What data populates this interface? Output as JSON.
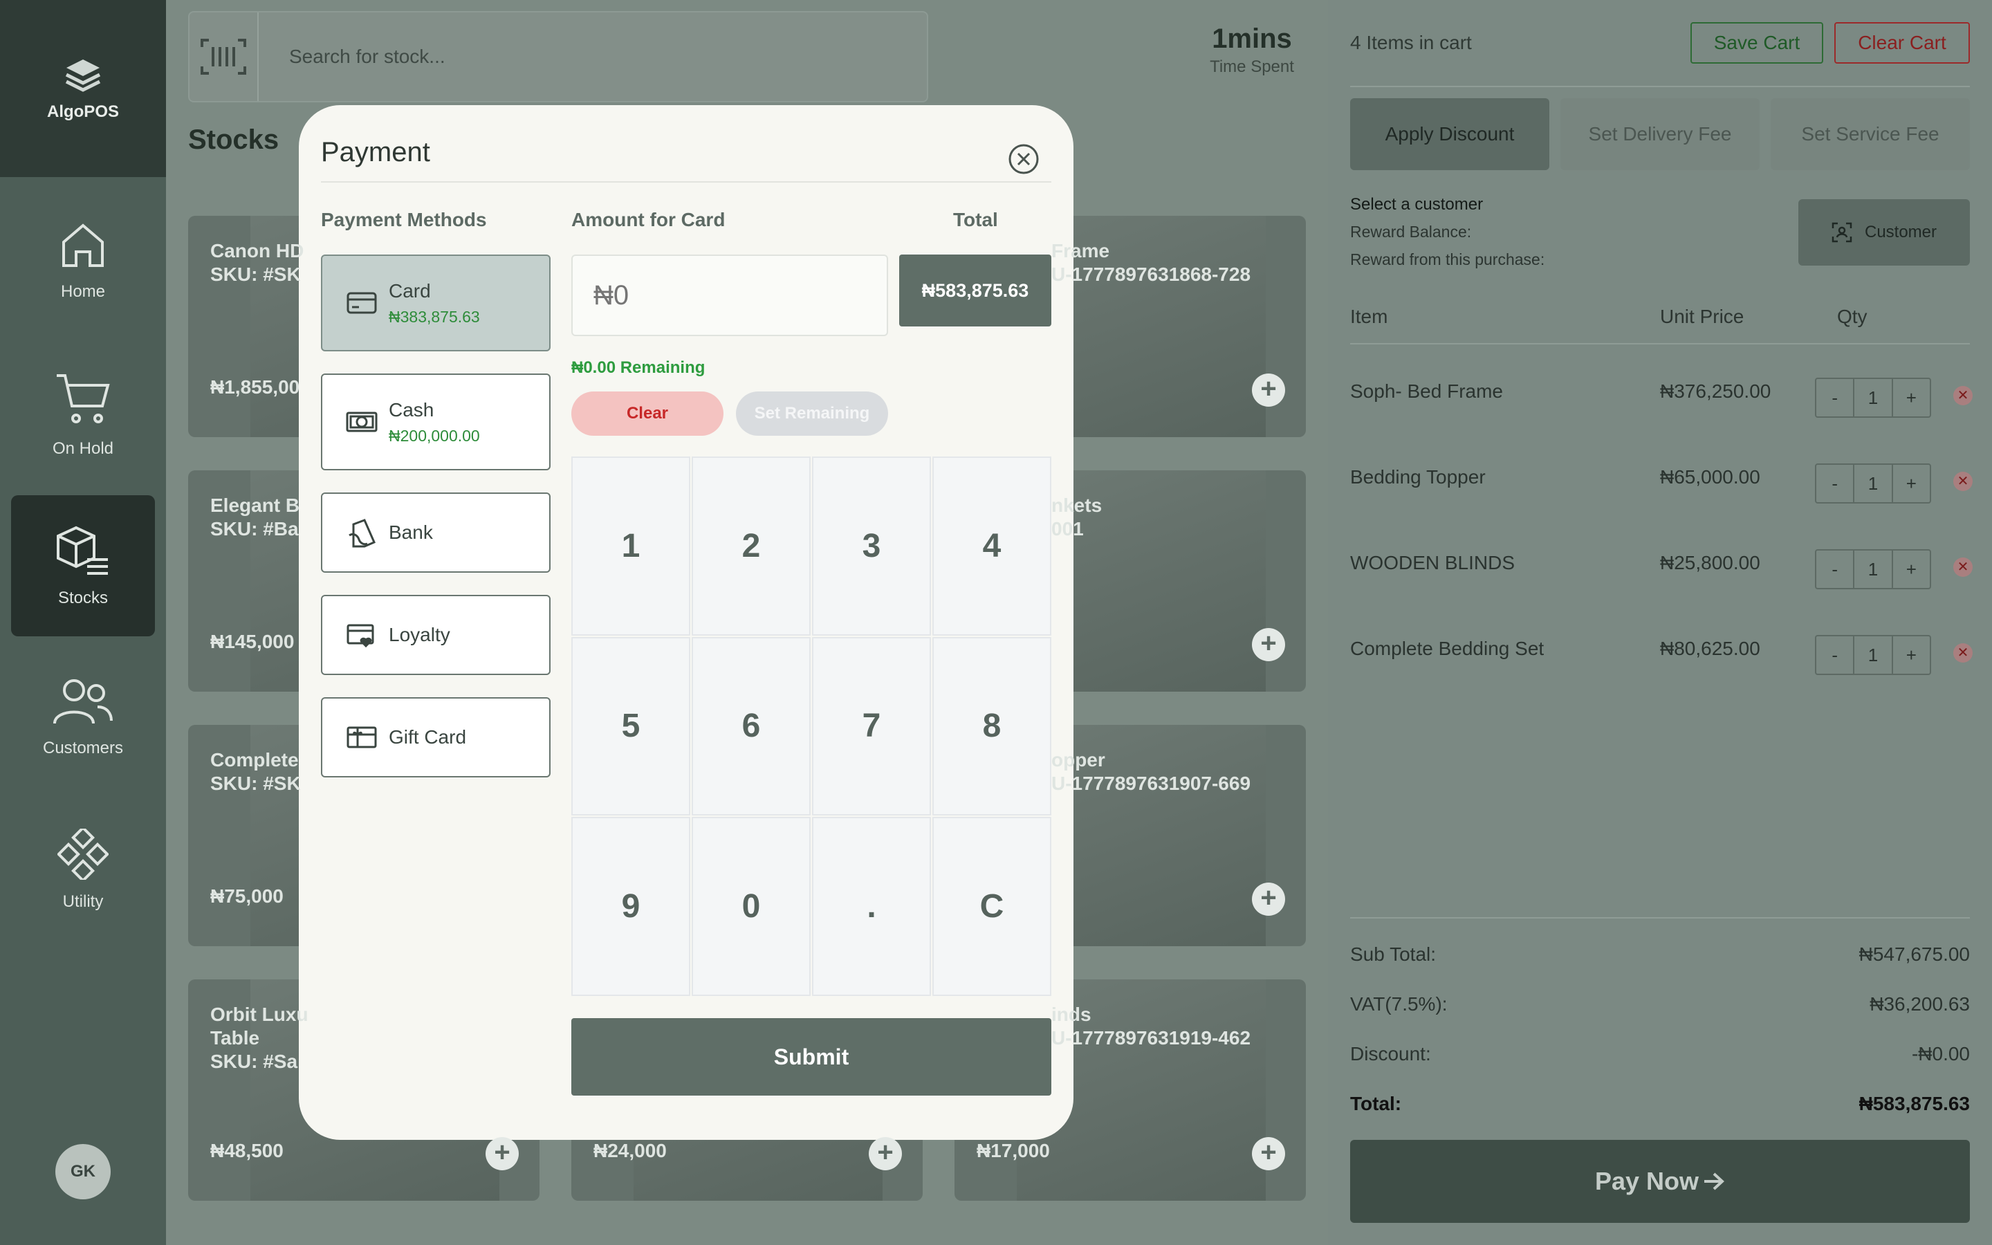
{
  "sidebar": {
    "brand": "AlgoPOS",
    "items": [
      {
        "label": "Home",
        "icon": "home-icon"
      },
      {
        "label": "On Hold",
        "icon": "cart-icon"
      },
      {
        "label": "Stocks",
        "icon": "box-list-icon",
        "active": true
      },
      {
        "label": "Customers",
        "icon": "users-icon"
      },
      {
        "label": "Utility",
        "icon": "diamonds-icon"
      }
    ],
    "avatar_initials": "GK"
  },
  "header": {
    "search_placeholder": "Search for stock...",
    "timer_value": "1mins",
    "timer_label": "Time Spent"
  },
  "stocks": {
    "title": "Stocks",
    "cards": [
      {
        "name": "Canon HD\nSKU: #SK",
        "price": "₦1,855,00"
      },
      {
        "name": "Frame\nU-1777897631868-728",
        "price": ""
      },
      {
        "name": "Elegant B\nSKU: #Ba",
        "price": "₦145,000"
      },
      {
        "name": "nkets\n001",
        "price": ""
      },
      {
        "name": "Complete\nSKU: #SK",
        "price": "₦75,000"
      },
      {
        "name": "opper\nU-1777897631907-669",
        "price": ""
      },
      {
        "name": "Orbit Luxu\nTable\nSKU: #Sa",
        "price": "₦48,500"
      },
      {
        "name": "",
        "price": "₦24,000"
      },
      {
        "name": "inds\nU-1777897631919-462",
        "price": "₦17,000"
      }
    ]
  },
  "cart": {
    "count_text": "4 Items in cart",
    "save_label": "Save Cart",
    "clear_label": "Clear Cart",
    "apply_discount": "Apply Discount",
    "set_delivery": "Set Delivery Fee",
    "set_service": "Set Service Fee",
    "select_customer": "Select a customer",
    "reward_balance": "Reward Balance:",
    "reward_purchase": "Reward from this purchase:",
    "customer_button": "Customer",
    "headers": {
      "item": "Item",
      "unit_price": "Unit Price",
      "qty": "Qty"
    },
    "items": [
      {
        "name": "Soph- Bed Frame",
        "price": "₦376,250.00",
        "qty": "1"
      },
      {
        "name": "Bedding Topper",
        "price": "₦65,000.00",
        "qty": "1"
      },
      {
        "name": "WOODEN BLINDS",
        "price": "₦25,800.00",
        "qty": "1"
      },
      {
        "name": "Complete Bedding Set",
        "price": "₦80,625.00",
        "qty": "1"
      }
    ],
    "subtotal_label": "Sub Total:",
    "subtotal": "₦547,675.00",
    "vat_label": "VAT(7.5%):",
    "vat": "₦36,200.63",
    "discount_label": "Discount:",
    "discount": "-₦0.00",
    "total_label": "Total:",
    "total": "₦583,875.63",
    "pay_now": "Pay Now"
  },
  "payment": {
    "title": "Payment",
    "methods_heading": "Payment Methods",
    "amount_heading": "Amount for Card",
    "total_heading": "Total",
    "methods": [
      {
        "label": "Card",
        "amount": "₦383,875.63",
        "icon": "card-icon",
        "selected": true
      },
      {
        "label": "Cash",
        "amount": "₦200,000.00",
        "icon": "cash-icon"
      },
      {
        "label": "Bank",
        "amount": "",
        "icon": "bank-icon"
      },
      {
        "label": "Loyalty",
        "amount": "",
        "icon": "loyalty-icon"
      },
      {
        "label": "Gift Card",
        "amount": "",
        "icon": "gift-card-icon"
      }
    ],
    "amount_placeholder": "₦0",
    "total": "₦583,875.63",
    "remaining": "₦0.00 Remaining",
    "clear_label": "Clear",
    "set_remaining_label": "Set Remaining",
    "keys": [
      "1",
      "2",
      "3",
      "4",
      "5",
      "6",
      "7",
      "8",
      "9",
      "0",
      ".",
      "C"
    ],
    "submit_label": "Submit"
  }
}
